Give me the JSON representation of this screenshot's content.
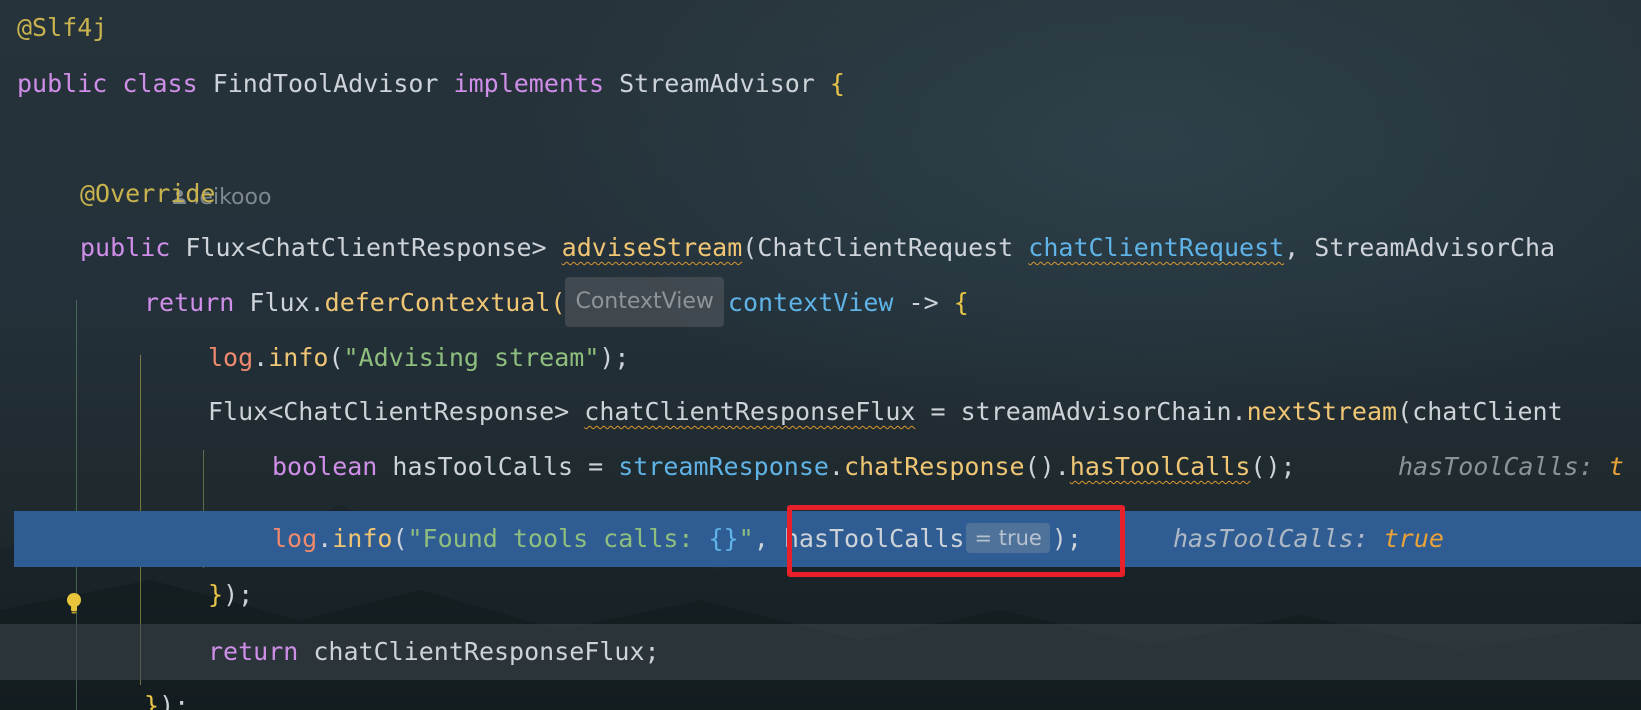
{
  "editor": {
    "lines": {
      "l1": {
        "annotation": "@Slf4j"
      },
      "l2": {
        "kw_public": "public",
        "kw_class": "class",
        "class_name": "FindToolAdvisor",
        "kw_implements": "implements",
        "interface": "StreamAdvisor",
        "brace": "{"
      },
      "l3": {
        "author": "leikooo"
      },
      "l4": {
        "annotation": "@Override"
      },
      "l5": {
        "kw_public": "public",
        "ret_type": "Flux<ChatClientResponse>",
        "method": "adviseStream",
        "open": "(",
        "p1_type": "ChatClientRequest",
        "p1_name": "chatClientRequest",
        "sep": ", ",
        "p2_type": "StreamAdvisorCha"
      },
      "l6": {
        "kw_return": "return",
        "obj": "Flux.",
        "method": "deferContextual",
        "open": "(",
        "inlay_type": "ContextView",
        "param": "contextView",
        "arrow": " -> ",
        "brace": "{"
      },
      "l7": {
        "field": "log",
        "dot": ".",
        "method": "info",
        "open": "(",
        "string": "\"Advising stream\"",
        "close": ");"
      },
      "l8": {
        "type": "Flux<ChatClientResponse>",
        "var": "chatClientResponseFlux",
        "assign": " = streamAdvisorChain.",
        "method": "nextStream",
        "rest": "(chatClient"
      },
      "l9": {
        "kw_boolean": "boolean",
        "var": "hasToolCalls",
        "assign": " = ",
        "param": "streamResponse",
        "dot": ".",
        "m1": "chatResponse",
        "paren1": "().",
        "m2": "hasToolCalls",
        "paren2": "();",
        "hint_label": "hasToolCalls:",
        "hint_value": "t"
      },
      "l10": {
        "field": "log",
        "dot": ".",
        "method": "info",
        "open": "(",
        "str_prefix": "\"Found tools calls: ",
        "placeholder": "{}",
        "str_suffix": "\"",
        "comma": ",",
        "arg": "hasToolCalls",
        "inlay_eq": "= true",
        "close": ");",
        "hint_label": "hasToolCalls:",
        "hint_value": "true"
      },
      "l11": {
        "brace": "}",
        "close": ");"
      },
      "l12": {
        "kw_return": "return",
        "var": "chatClientResponseFlux;"
      },
      "l13": {
        "brace": "}",
        "close": ");"
      }
    }
  },
  "colors": {
    "debug_line": "#2f5c92",
    "highlight_box": "#e8202a",
    "keyword": "#cf8ee8",
    "annotation": "#c8b34e",
    "function": "#f0c674",
    "string": "#8fbf7f",
    "parameter": "#5fb3e6"
  }
}
